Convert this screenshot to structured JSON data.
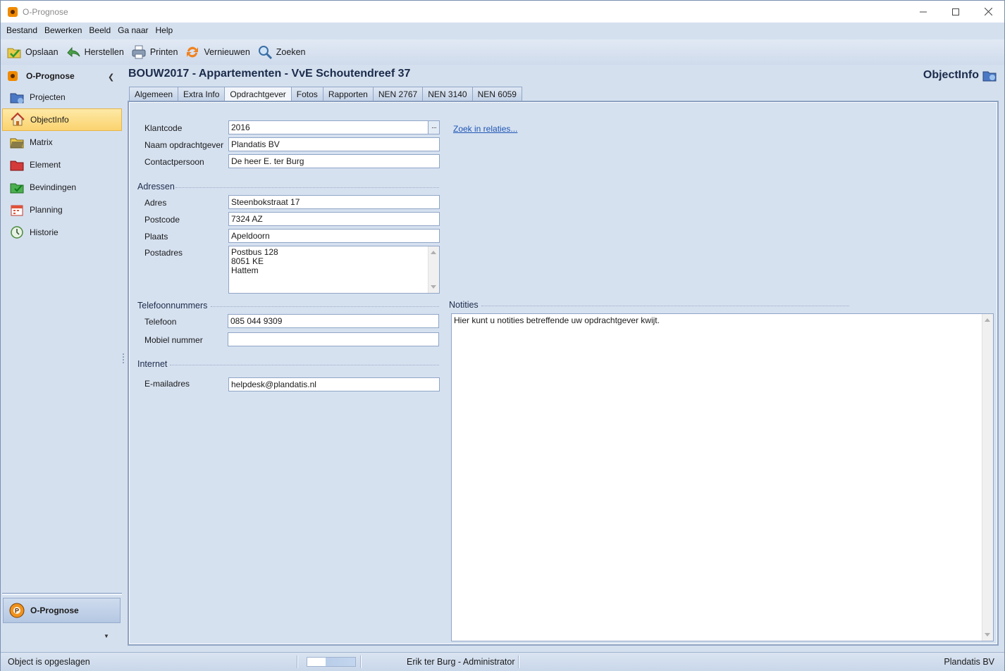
{
  "window": {
    "title": "O-Prognose"
  },
  "menu": [
    "Bestand",
    "Bewerken",
    "Beeld",
    "Ga naar",
    "Help"
  ],
  "toolbar": {
    "save": "Opslaan",
    "restore": "Herstellen",
    "print": "Printen",
    "refresh": "Vernieuwen",
    "search": "Zoeken"
  },
  "nav": {
    "header": "O-Prognose",
    "items": [
      "Projecten",
      "ObjectInfo",
      "Matrix",
      "Element",
      "Bevindingen",
      "Planning",
      "Historie"
    ],
    "active": "ObjectInfo",
    "bottom_button": "O-Prognose"
  },
  "main": {
    "title": "BOUW2017 - Appartementen - VvE Schoutendreef 37",
    "module": "ObjectInfo",
    "tabs": [
      "Algemeen",
      "Extra Info",
      "Opdrachtgever",
      "Fotos",
      "Rapporten",
      "NEN 2767",
      "NEN 3140",
      "NEN 6059"
    ],
    "active_tab": "Opdrachtgever"
  },
  "form": {
    "klantcode_label": "Klantcode",
    "klantcode": "2016",
    "ellipsis": "···",
    "search_link": "Zoek in relaties...",
    "naam_label": "Naam opdrachtgever",
    "naam": "Plandatis BV",
    "contact_label": "Contactpersoon",
    "contact": "De heer E. ter Burg",
    "adressen_group": "Adressen",
    "adres_label": "Adres",
    "adres": "Steenbokstraat 17",
    "postcode_label": "Postcode",
    "postcode": "7324 AZ",
    "plaats_label": "Plaats",
    "plaats": "Apeldoorn",
    "postadres_label": "Postadres",
    "postadres_lines": [
      "Postbus 128",
      "8051 KE",
      "Hattem"
    ],
    "telefoon_group": "Telefoonnummers",
    "telefoon_label": "Telefoon",
    "telefoon": "085 044 9309",
    "mobiel_label": "Mobiel nummer",
    "mobiel": "",
    "internet_group": "Internet",
    "email_label": "E-mailadres",
    "email": "helpdesk@plandatis.nl",
    "notities_group": "Notities",
    "notities": "Hier kunt u notities betreffende uw opdrachtgever kwijt."
  },
  "status": {
    "message": "Object is opgeslagen",
    "progress": 0.38,
    "user": "Erik ter Burg - Administrator",
    "company": "Plandatis BV"
  }
}
